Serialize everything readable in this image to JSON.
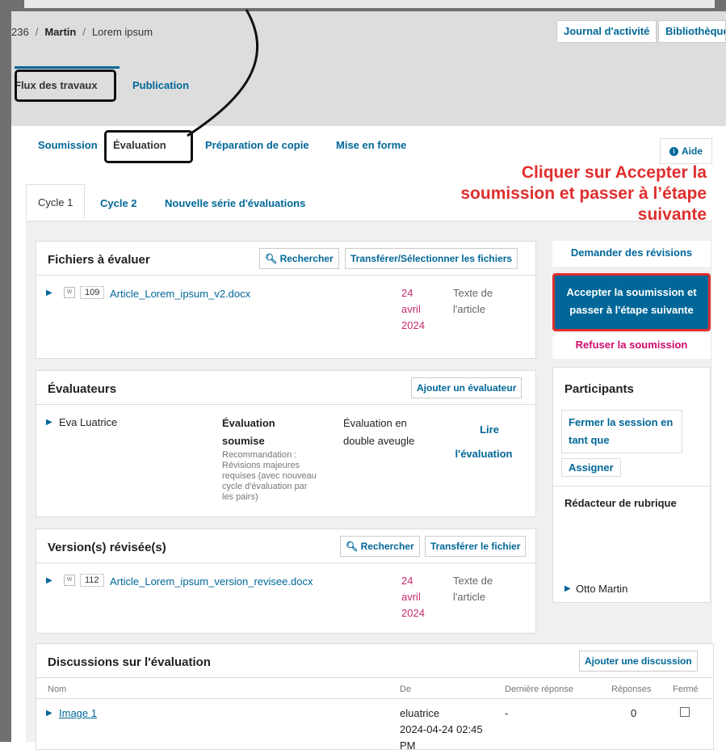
{
  "header": {
    "breadcrumb": {
      "id": "236",
      "sep1": "/",
      "author": "Martin",
      "sep2": "/",
      "title": "Lorem ipsum"
    },
    "buttons": {
      "activity_log": "Journal d'activité",
      "library": "Bibliothèque"
    },
    "tabs": {
      "workflow": "Flux des travaux",
      "publication": "Publication"
    }
  },
  "stage_tabs": [
    "Soumission",
    "Évaluation",
    "Préparation de copie",
    "Mise en forme"
  ],
  "help": {
    "icon": "info-icon",
    "label": "Aide"
  },
  "annotation": "Cliquer sur Accepter la soumission et passer à l’étape suivante",
  "cycle_tabs": [
    "Cycle 1",
    "Cycle 2",
    "Nouvelle série d'évaluations"
  ],
  "review_files": {
    "title": "Fichiers à évaluer",
    "search_label": "Rechercher",
    "upload_label": "Transférer/Sélectionner les fichiers",
    "files": [
      {
        "id": "109",
        "name": "Article_Lorem_ipsum_v2.docx",
        "date_day": "24",
        "date_month": "avril",
        "date_year": "2024",
        "type_line1": "Texte de",
        "type_line2": "l'article"
      }
    ]
  },
  "reviewers": {
    "title": "Évaluateurs",
    "add_label": "Ajouter un évaluateur",
    "rows": [
      {
        "name": "Eva Luatrice",
        "status_line1": "Évaluation",
        "status_line2": "soumise",
        "recommendation": [
          "Recommandation :",
          "Révisions majeures",
          "requises (avec nouveau",
          "cycle d'évaluation par",
          "les pairs)"
        ],
        "method_line1": "Évaluation en",
        "method_line2": "double aveugle",
        "action_line1": "Lire",
        "action_line2": "l'évaluation"
      }
    ]
  },
  "revisions": {
    "title": "Version(s) révisée(s)",
    "search_label": "Rechercher",
    "upload_label": "Transférer le fichier",
    "files": [
      {
        "id": "112",
        "name": "Article_Lorem_ipsum_version_revisee.docx",
        "date_day": "24",
        "date_month": "avril",
        "date_year": "2024",
        "type_line1": "Texte de",
        "type_line2": "l'article"
      }
    ]
  },
  "discussions": {
    "title": "Discussions sur l'évaluation",
    "add_label": "Ajouter une discussion",
    "columns": [
      "Nom",
      "De",
      "Dernière réponse",
      "Réponses",
      "Fermé"
    ],
    "rows": [
      {
        "name": "Image 1",
        "from_line1": "eluatrice",
        "from_line2": "2024-04-24 02:45",
        "from_line3": "PM",
        "last_reply": "-",
        "replies": "0"
      }
    ]
  },
  "decisions": {
    "request_revisions": "Demander des révisions",
    "accept_line1": "Accepter la soumission et",
    "accept_line2": "passer à l'étape suivante",
    "decline": "Refuser la soumission"
  },
  "participants": {
    "title": "Participants",
    "logout_line1": "Fermer la session en",
    "logout_line2": "tant que",
    "assign_label": "Assigner",
    "role_label": "Rédacteur de rubrique",
    "member": "Otto Martin"
  }
}
